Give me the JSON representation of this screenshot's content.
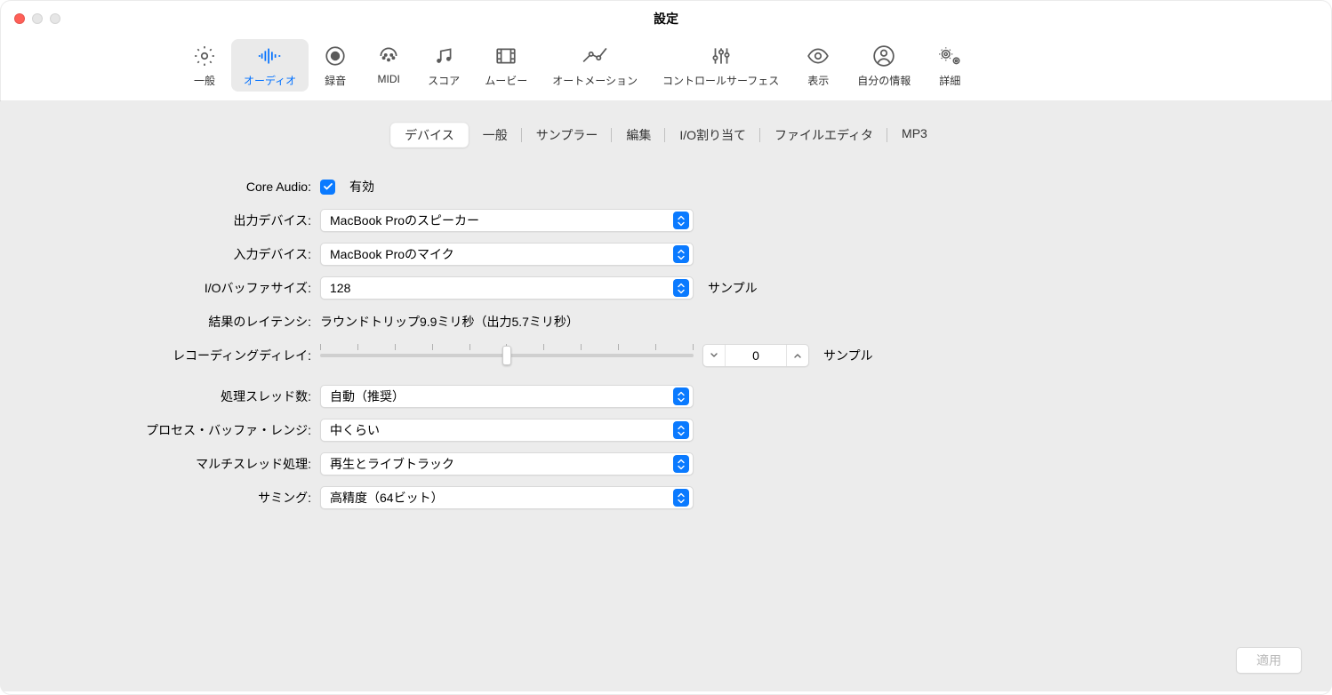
{
  "window": {
    "title": "設定"
  },
  "toolbar": {
    "general": "一般",
    "audio": "オーディオ",
    "recording": "録音",
    "midi": "MIDI",
    "score": "スコア",
    "movie": "ムービー",
    "automation": "オートメーション",
    "control_surfaces": "コントロールサーフェス",
    "display": "表示",
    "my_info": "自分の情報",
    "advanced": "詳細"
  },
  "tabs": {
    "devices": "デバイス",
    "general": "一般",
    "sampler": "サンプラー",
    "editing": "編集",
    "io_assignments": "I/O割り当て",
    "file_editor": "ファイルエディタ",
    "mp3": "MP3"
  },
  "form": {
    "core_audio_label": "Core Audio:",
    "core_audio_enabled": "有効",
    "output_device_label": "出力デバイス:",
    "output_device_value": "MacBook Proのスピーカー",
    "input_device_label": "入力デバイス:",
    "input_device_value": "MacBook Proのマイク",
    "io_buffer_label": "I/Oバッファサイズ:",
    "io_buffer_value": "128",
    "io_buffer_suffix": "サンプル",
    "latency_label": "結果のレイテンシ:",
    "latency_value": "ラウンドトリップ9.9ミリ秒（出力5.7ミリ秒）",
    "recording_delay_label": "レコーディングディレイ:",
    "recording_delay_value": "0",
    "recording_delay_suffix": "サンプル",
    "processing_threads_label": "処理スレッド数:",
    "processing_threads_value": "自動（推奨）",
    "process_buffer_range_label": "プロセス・バッファ・レンジ:",
    "process_buffer_range_value": "中くらい",
    "multithreading_label": "マルチスレッド処理:",
    "multithreading_value": "再生とライブトラック",
    "summing_label": "サミング:",
    "summing_value": "高精度（64ビット）"
  },
  "buttons": {
    "apply": "適用"
  }
}
